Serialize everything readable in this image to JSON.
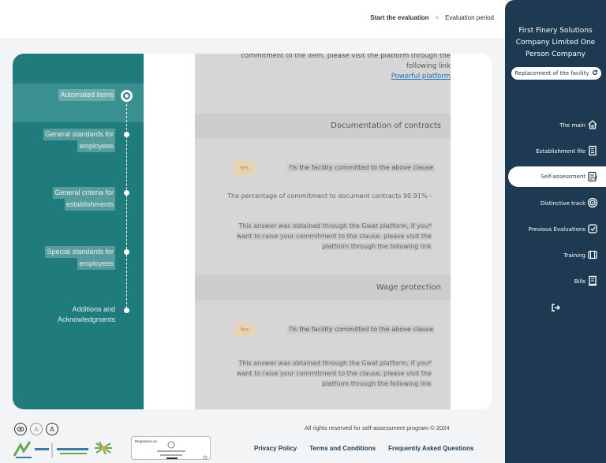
{
  "header": {
    "breadcrumb_current": "Start the evaluation",
    "breadcrumb_sep": "<",
    "breadcrumb_parent": "Evaluation period"
  },
  "sidebar": {
    "company_line1": "First Finery Solutions",
    "company_line2": "Company Limited One",
    "company_line3": "Person Company",
    "replace_label": "Replacement of the facility",
    "items": [
      {
        "label": "The main",
        "icon": "home-icon",
        "active": false
      },
      {
        "label": "Establishment file",
        "icon": "file-icon",
        "active": false
      },
      {
        "label": "Self-assessment",
        "icon": "clipboard-icon",
        "active": true
      },
      {
        "label": "Distinctive track",
        "icon": "target-icon",
        "active": false
      },
      {
        "label": "Previous Evaluations",
        "icon": "history-icon",
        "active": false
      },
      {
        "label": "Training",
        "icon": "book-icon",
        "active": false
      },
      {
        "label": "Bills",
        "icon": "invoice-icon",
        "active": false
      },
      {
        "label": "",
        "icon": "logout-icon",
        "active": false
      }
    ]
  },
  "steps": [
    {
      "label": "Automated items",
      "active": true
    },
    {
      "label_line1": "General standards for",
      "label_line2": "employees"
    },
    {
      "label_line1": "General criteria for",
      "label_line2": "establishments"
    },
    {
      "label_line1": "Special standards for",
      "label_line2": "employees"
    },
    {
      "label_line1": "Additions and",
      "label_line2": "Acknowledgments"
    }
  ],
  "content": {
    "top_text_line1": "commitment to the item, please visit the platform through the",
    "top_text_line2": "following link",
    "top_link": "Powerful platform",
    "section1": {
      "title": "Documentation of contracts",
      "question": "?Is the facility committed to the above clause",
      "answer": "Yes",
      "percentage": "The percentage of commitment to document contracts 90.91% -",
      "note_line1": "This answer was obtained through the Gwat platform, if you*",
      "note_line2": "want to raise your commitment to the clause, please visit the",
      "note_line3": "platform through the following link"
    },
    "section2": {
      "title": "Wage protection",
      "question": "?Is the facility committed to the above clause",
      "answer": "Yes",
      "note_line1": "This answer was obtained through the Gwat platform, if you*",
      "note_line2": "want to raise your commitment to the clause, please visit the",
      "note_line3": "platform through the following link"
    }
  },
  "footer": {
    "copyright": "All rights reserved for self-assessment program © 2024",
    "privacy": "Privacy Policy",
    "terms": "Terms and Conditions",
    "faq": "Frequently Asked Questions",
    "badge_text": "Registered on"
  },
  "colors": {
    "sidebar_bg": "#1e3a52",
    "steps_bg": "#1f7b7c",
    "link": "#1f6fb5",
    "yes_bg": "#e6d2b5"
  }
}
